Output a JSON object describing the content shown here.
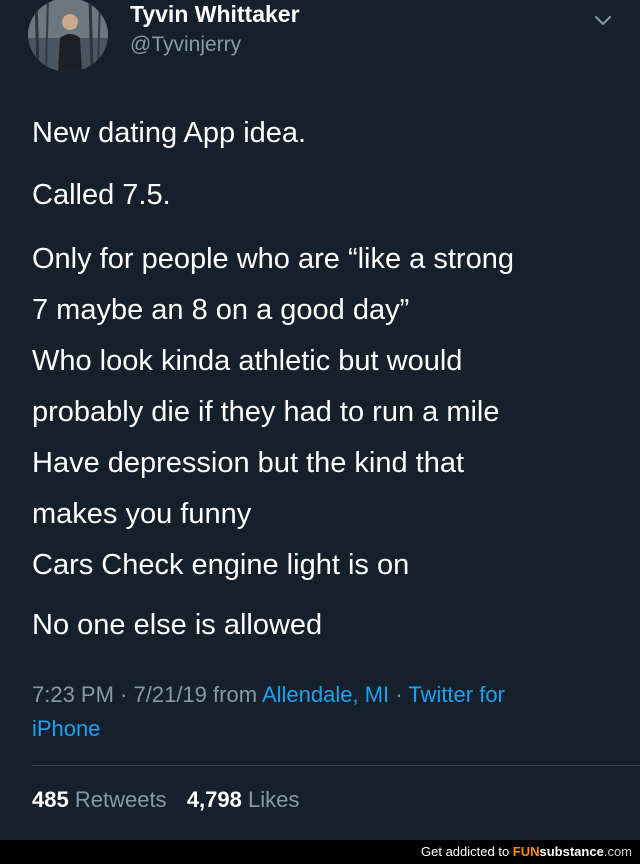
{
  "author": {
    "name": "Tyvin Whittaker",
    "handle": "@Tyvinjerry"
  },
  "icons": {
    "menu": "chevron-down-icon",
    "avatar": "profile-photo"
  },
  "tweet": {
    "lines": [
      "New dating App idea.",
      "Called 7.5.",
      "Only for people who are “like a strong",
      "7 maybe an 8 on a good day”",
      "Who look kinda athletic but would",
      "probably die if they had to run a mile",
      "Have depression but the kind that",
      "makes you funny",
      "Cars Check engine light is on",
      "No one else is allowed"
    ]
  },
  "meta": {
    "time": "7:23 PM",
    "separator": "·",
    "date": "7/21/19",
    "from_label": "from",
    "location": "Allendale, MI",
    "source_line1": "Twitter for",
    "source_line2": "iPhone"
  },
  "stats": {
    "retweets_count": "485",
    "retweets_label": "Retweets",
    "likes_count": "4,798",
    "likes_label": "Likes"
  },
  "footer": {
    "prefix": "Get addicted to",
    "brand_fun": "FUN",
    "brand_substance": "substance",
    "brand_tld": ".com"
  },
  "colors": {
    "background": "#15202b",
    "link": "#1da1f2",
    "secondary_text": "#8899a6",
    "divider": "#38444d"
  }
}
